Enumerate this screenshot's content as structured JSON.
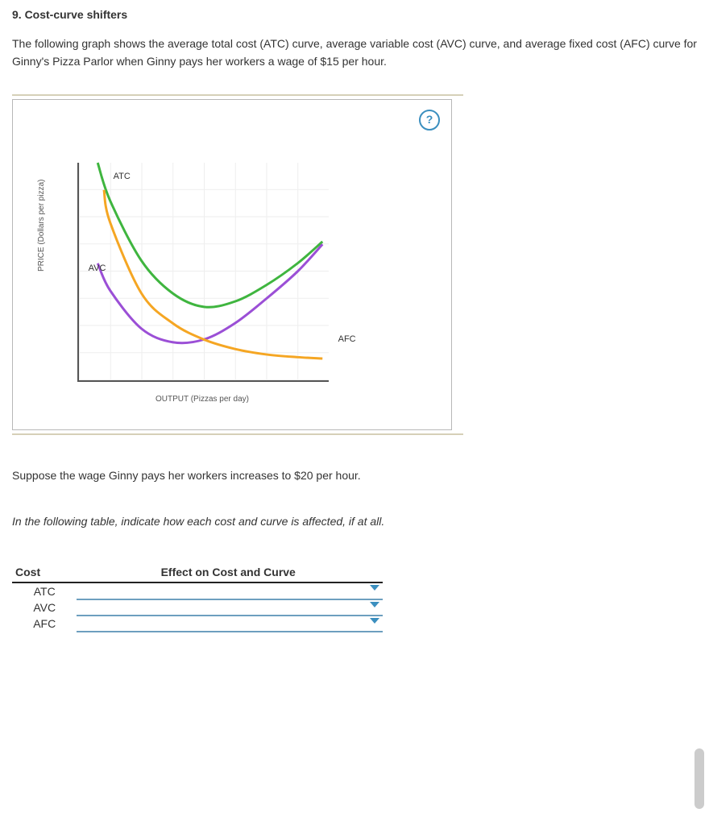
{
  "heading": "9. Cost-curve shifters",
  "intro": "The following graph shows the average total cost (ATC) curve, average variable cost (AVC) curve, and average fixed cost (AFC) curve for Ginny's Pizza Parlor when Ginny pays her workers a wage of $15 per hour.",
  "help_symbol": "?",
  "chart_data": {
    "type": "line",
    "title": "",
    "xlabel": "OUTPUT (Pizzas per day)",
    "ylabel": "PRICE (Dollars per pizza)",
    "xlim": [
      0,
      8
    ],
    "ylim": [
      0,
      8
    ],
    "grid": true,
    "series": [
      {
        "name": "ATC",
        "color": "#3fb53f",
        "x": [
          0.6,
          1,
          2,
          3,
          4,
          5,
          6,
          7,
          7.8
        ],
        "y": [
          8.0,
          6.6,
          4.4,
          3.2,
          2.7,
          2.9,
          3.5,
          4.3,
          5.1
        ],
        "label_pos": {
          "x": 1.1,
          "y": 7.7
        }
      },
      {
        "name": "AVC",
        "color": "#9b4fd6",
        "x": [
          0.6,
          1,
          2,
          3,
          4,
          5,
          6,
          7,
          7.8
        ],
        "y": [
          4.3,
          3.3,
          1.9,
          1.4,
          1.5,
          2.1,
          3.0,
          4.0,
          5.0
        ],
        "label_pos": {
          "x": 0.3,
          "y": 4.3
        }
      },
      {
        "name": "AFC",
        "color": "#f5a623",
        "x": [
          0.8,
          1,
          2,
          3,
          4,
          5,
          6,
          7,
          7.8
        ],
        "y": [
          7.0,
          5.8,
          3.2,
          2.1,
          1.5,
          1.15,
          0.95,
          0.85,
          0.8
        ],
        "label_pos": {
          "x": 8.3,
          "y": 1.7
        }
      }
    ]
  },
  "prompt": "Suppose the wage Ginny pays her workers increases to $20 per hour.",
  "instruction": "In the following table, indicate how each cost and curve is affected, if at all.",
  "table": {
    "col_headers": [
      "Cost",
      "Effect on Cost and Curve"
    ],
    "rows": [
      {
        "label": "ATC",
        "value": ""
      },
      {
        "label": "AVC",
        "value": ""
      },
      {
        "label": "AFC",
        "value": ""
      }
    ]
  }
}
